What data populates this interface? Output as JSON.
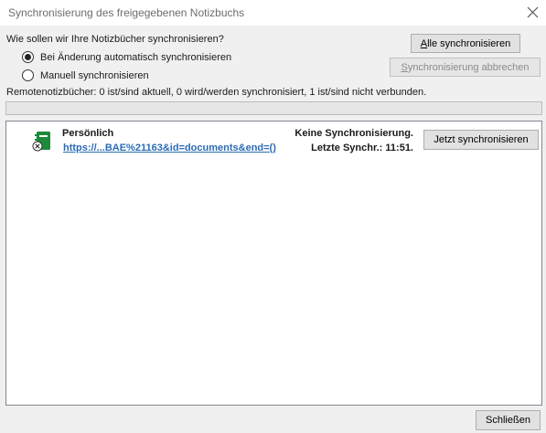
{
  "window": {
    "title": "Synchronisierung des freigegebenen Notizbuchs",
    "close_icon": "close-icon"
  },
  "sync": {
    "question": "Wie sollen wir Ihre Notizbücher synchronisieren?",
    "options": [
      {
        "label": "Bei Änderung automatisch synchronisieren",
        "checked": true
      },
      {
        "label": "Manuell synchronisieren",
        "checked": false
      }
    ],
    "sync_all_prefix": "A",
    "sync_all_rest": "lle synchronisieren",
    "cancel_prefix": "S",
    "cancel_rest": "ynchronisierung abbrechen"
  },
  "status": {
    "summary": "Remotenotizbücher: 0 ist/sind aktuell, 0 wird/werden synchronisiert, 1 ist/sind nicht verbunden.",
    "progress": 0
  },
  "notebooks": [
    {
      "name": "Persönlich",
      "url": "https://...BAE%21163&id=documents&end=()",
      "status": "Keine Synchronisierung.",
      "last_sync": "Letzte Synchr.: 11:51.",
      "sync_now_label": "Jetzt synchronisieren",
      "icon": "notebook-disconnected-icon",
      "icon_color": "#1d8a3a"
    }
  ],
  "footer": {
    "close_label": "Schließen"
  }
}
